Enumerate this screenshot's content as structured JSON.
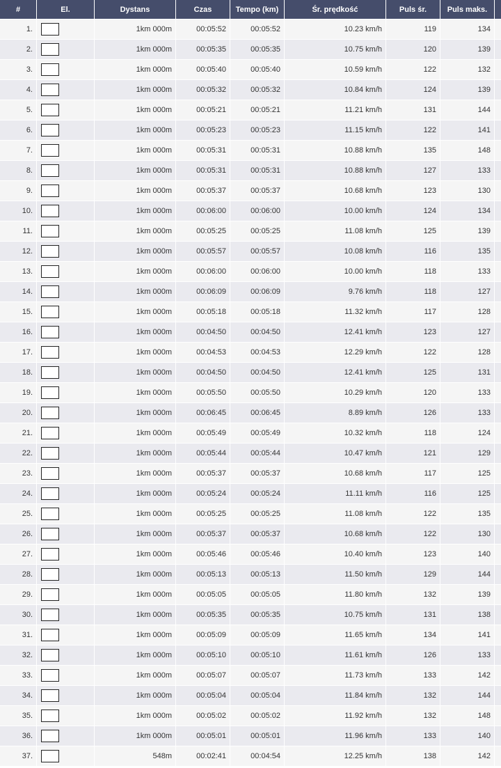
{
  "headers": [
    "#",
    "El.",
    "Dystans",
    "Czas",
    "Tempo (km)",
    "Śr. prędkość",
    "Puls śr.",
    "Puls maks."
  ],
  "rows": [
    [
      "1.",
      "",
      "1km 000m",
      "00:05:52",
      "00:05:52",
      "10.23 km/h",
      "119",
      "134"
    ],
    [
      "2.",
      "",
      "1km 000m",
      "00:05:35",
      "00:05:35",
      "10.75 km/h",
      "120",
      "139"
    ],
    [
      "3.",
      "",
      "1km 000m",
      "00:05:40",
      "00:05:40",
      "10.59 km/h",
      "122",
      "132"
    ],
    [
      "4.",
      "",
      "1km 000m",
      "00:05:32",
      "00:05:32",
      "10.84 km/h",
      "124",
      "139"
    ],
    [
      "5.",
      "",
      "1km 000m",
      "00:05:21",
      "00:05:21",
      "11.21 km/h",
      "131",
      "144"
    ],
    [
      "6.",
      "",
      "1km 000m",
      "00:05:23",
      "00:05:23",
      "11.15 km/h",
      "122",
      "141"
    ],
    [
      "7.",
      "",
      "1km 000m",
      "00:05:31",
      "00:05:31",
      "10.88 km/h",
      "135",
      "148"
    ],
    [
      "8.",
      "",
      "1km 000m",
      "00:05:31",
      "00:05:31",
      "10.88 km/h",
      "127",
      "133"
    ],
    [
      "9.",
      "",
      "1km 000m",
      "00:05:37",
      "00:05:37",
      "10.68 km/h",
      "123",
      "130"
    ],
    [
      "10.",
      "",
      "1km 000m",
      "00:06:00",
      "00:06:00",
      "10.00 km/h",
      "124",
      "134"
    ],
    [
      "11.",
      "",
      "1km 000m",
      "00:05:25",
      "00:05:25",
      "11.08 km/h",
      "125",
      "139"
    ],
    [
      "12.",
      "",
      "1km 000m",
      "00:05:57",
      "00:05:57",
      "10.08 km/h",
      "116",
      "135"
    ],
    [
      "13.",
      "",
      "1km 000m",
      "00:06:00",
      "00:06:00",
      "10.00 km/h",
      "118",
      "133"
    ],
    [
      "14.",
      "",
      "1km 000m",
      "00:06:09",
      "00:06:09",
      "9.76 km/h",
      "118",
      "127"
    ],
    [
      "15.",
      "",
      "1km 000m",
      "00:05:18",
      "00:05:18",
      "11.32 km/h",
      "117",
      "128"
    ],
    [
      "16.",
      "",
      "1km 000m",
      "00:04:50",
      "00:04:50",
      "12.41 km/h",
      "123",
      "127"
    ],
    [
      "17.",
      "",
      "1km 000m",
      "00:04:53",
      "00:04:53",
      "12.29 km/h",
      "122",
      "128"
    ],
    [
      "18.",
      "",
      "1km 000m",
      "00:04:50",
      "00:04:50",
      "12.41 km/h",
      "125",
      "131"
    ],
    [
      "19.",
      "",
      "1km 000m",
      "00:05:50",
      "00:05:50",
      "10.29 km/h",
      "120",
      "133"
    ],
    [
      "20.",
      "",
      "1km 000m",
      "00:06:45",
      "00:06:45",
      "8.89 km/h",
      "126",
      "133"
    ],
    [
      "21.",
      "",
      "1km 000m",
      "00:05:49",
      "00:05:49",
      "10.32 km/h",
      "118",
      "124"
    ],
    [
      "22.",
      "",
      "1km 000m",
      "00:05:44",
      "00:05:44",
      "10.47 km/h",
      "121",
      "129"
    ],
    [
      "23.",
      "",
      "1km 000m",
      "00:05:37",
      "00:05:37",
      "10.68 km/h",
      "117",
      "125"
    ],
    [
      "24.",
      "",
      "1km 000m",
      "00:05:24",
      "00:05:24",
      "11.11 km/h",
      "116",
      "125"
    ],
    [
      "25.",
      "",
      "1km 000m",
      "00:05:25",
      "00:05:25",
      "11.08 km/h",
      "122",
      "135"
    ],
    [
      "26.",
      "",
      "1km 000m",
      "00:05:37",
      "00:05:37",
      "10.68 km/h",
      "122",
      "130"
    ],
    [
      "27.",
      "",
      "1km 000m",
      "00:05:46",
      "00:05:46",
      "10.40 km/h",
      "123",
      "140"
    ],
    [
      "28.",
      "",
      "1km 000m",
      "00:05:13",
      "00:05:13",
      "11.50 km/h",
      "129",
      "144"
    ],
    [
      "29.",
      "",
      "1km 000m",
      "00:05:05",
      "00:05:05",
      "11.80 km/h",
      "132",
      "139"
    ],
    [
      "30.",
      "",
      "1km 000m",
      "00:05:35",
      "00:05:35",
      "10.75 km/h",
      "131",
      "138"
    ],
    [
      "31.",
      "",
      "1km 000m",
      "00:05:09",
      "00:05:09",
      "11.65 km/h",
      "134",
      "141"
    ],
    [
      "32.",
      "",
      "1km 000m",
      "00:05:10",
      "00:05:10",
      "11.61 km/h",
      "126",
      "133"
    ],
    [
      "33.",
      "",
      "1km 000m",
      "00:05:07",
      "00:05:07",
      "11.73 km/h",
      "133",
      "142"
    ],
    [
      "34.",
      "",
      "1km 000m",
      "00:05:04",
      "00:05:04",
      "11.84 km/h",
      "132",
      "144"
    ],
    [
      "35.",
      "",
      "1km 000m",
      "00:05:02",
      "00:05:02",
      "11.92 km/h",
      "132",
      "148"
    ],
    [
      "36.",
      "",
      "1km 000m",
      "00:05:01",
      "00:05:01",
      "11.96 km/h",
      "133",
      "140"
    ],
    [
      "37.",
      "",
      "548m",
      "00:02:41",
      "00:04:54",
      "12.25 km/h",
      "138",
      "142"
    ]
  ],
  "colors": {
    "header_bg": "#454d6b",
    "header_text": "#ffffff",
    "row_light": "#f5f5f5",
    "row_dark": "#eaeaef"
  }
}
